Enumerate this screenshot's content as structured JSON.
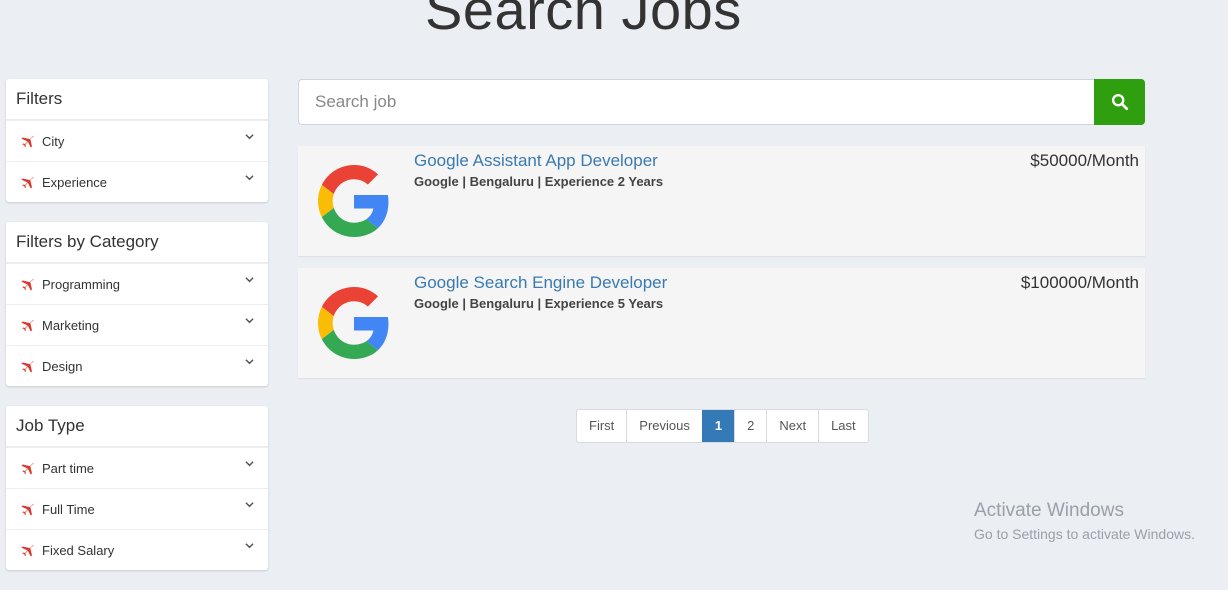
{
  "page": {
    "title": "Search Jobs"
  },
  "sidebar": {
    "panels": [
      {
        "heading": "Filters",
        "items": [
          "City",
          "Experience"
        ]
      },
      {
        "heading": "Filters by Category",
        "items": [
          "Programming",
          "Marketing",
          "Design"
        ]
      },
      {
        "heading": "Job Type",
        "items": [
          "Part time",
          "Full Time",
          "Fixed Salary"
        ]
      }
    ],
    "item_icon": "plane-icon",
    "chevron_icon": "chevron-down-icon"
  },
  "search": {
    "placeholder": "Search job",
    "value": "",
    "button_icon": "search-icon"
  },
  "jobs": [
    {
      "title": "Google Assistant App Developer",
      "meta": "Google | Bengaluru | Experience 2 Years",
      "salary": "$50000/Month",
      "logo": "google-logo"
    },
    {
      "title": "Google Search Engine Developer",
      "meta": "Google | Bengaluru | Experience 5 Years",
      "salary": "$100000/Month",
      "logo": "google-logo"
    }
  ],
  "pagination": {
    "first": "First",
    "previous": "Previous",
    "pages": [
      "1",
      "2"
    ],
    "active_page": "1",
    "next": "Next",
    "last": "Last"
  },
  "watermark": {
    "title": "Activate Windows",
    "subtitle": "Go to Settings to activate Windows."
  },
  "colors": {
    "accent": "#337ab7",
    "search_button": "#2f9e0f",
    "link": "#3a7ab0",
    "icon_red": "#d9392e",
    "background": "#ebeef3"
  }
}
